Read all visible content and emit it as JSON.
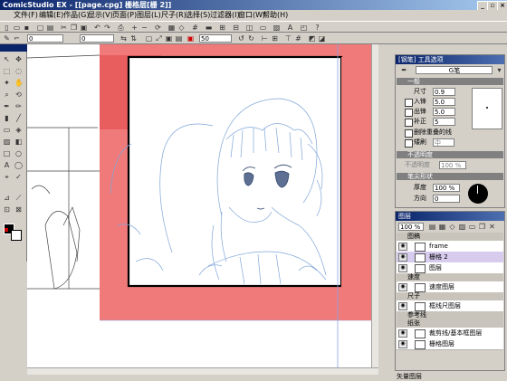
{
  "window": {
    "title": "ComicStudio EX - [[page.cpg] 栅格层[栅 2]]",
    "buttons": [
      "_",
      "▫",
      "×"
    ]
  },
  "menu": [
    "文件(F)",
    "编辑(E)",
    "作品(G)",
    "显示(V)",
    "页面(P)",
    "图层(L)",
    "尺子(R)",
    "选择(S)",
    "过滤器(I)",
    "窗口(W)",
    "帮助(H)"
  ],
  "toolbar2": {
    "size_value": "0",
    "angle_value": "0",
    "zoom_value": "50"
  },
  "tool_options": {
    "title": "[钢笔] 工具选项",
    "preset": "G笔",
    "section_general": "一般",
    "size_label": "尺寸",
    "size_value": "0.9 mm",
    "entry_label": "入锋",
    "entry_value": "5.0 mm",
    "exit_label": "出锋",
    "exit_value": "5.0 mm",
    "correction_label": "补正",
    "correction_value": "5",
    "delete_overlap_label": "删除重叠的线",
    "reference_label": "矮刷",
    "reference_value": "中",
    "section_opacity": "不透明度",
    "opacity_label": "不透明度",
    "opacity_value": "100 %",
    "section_brush": "笔尖形状",
    "thickness_label": "厚度",
    "thickness_value": "100 %",
    "direction_label": "方向",
    "direction_value": "0"
  },
  "layers": {
    "title": "图层",
    "opacity": "100 %",
    "groups": {
      "draft": "图稿",
      "mask": "速度",
      "ruler": "尺子",
      "guide": "参考线",
      "base": "纸张"
    },
    "items": [
      "frame",
      "栅格 2",
      "图层",
      "速度图层",
      "框线尺图层",
      "裁剪线/基本框图层",
      "栅格图层"
    ]
  },
  "statusbar": {
    "text": "矢量图层"
  }
}
